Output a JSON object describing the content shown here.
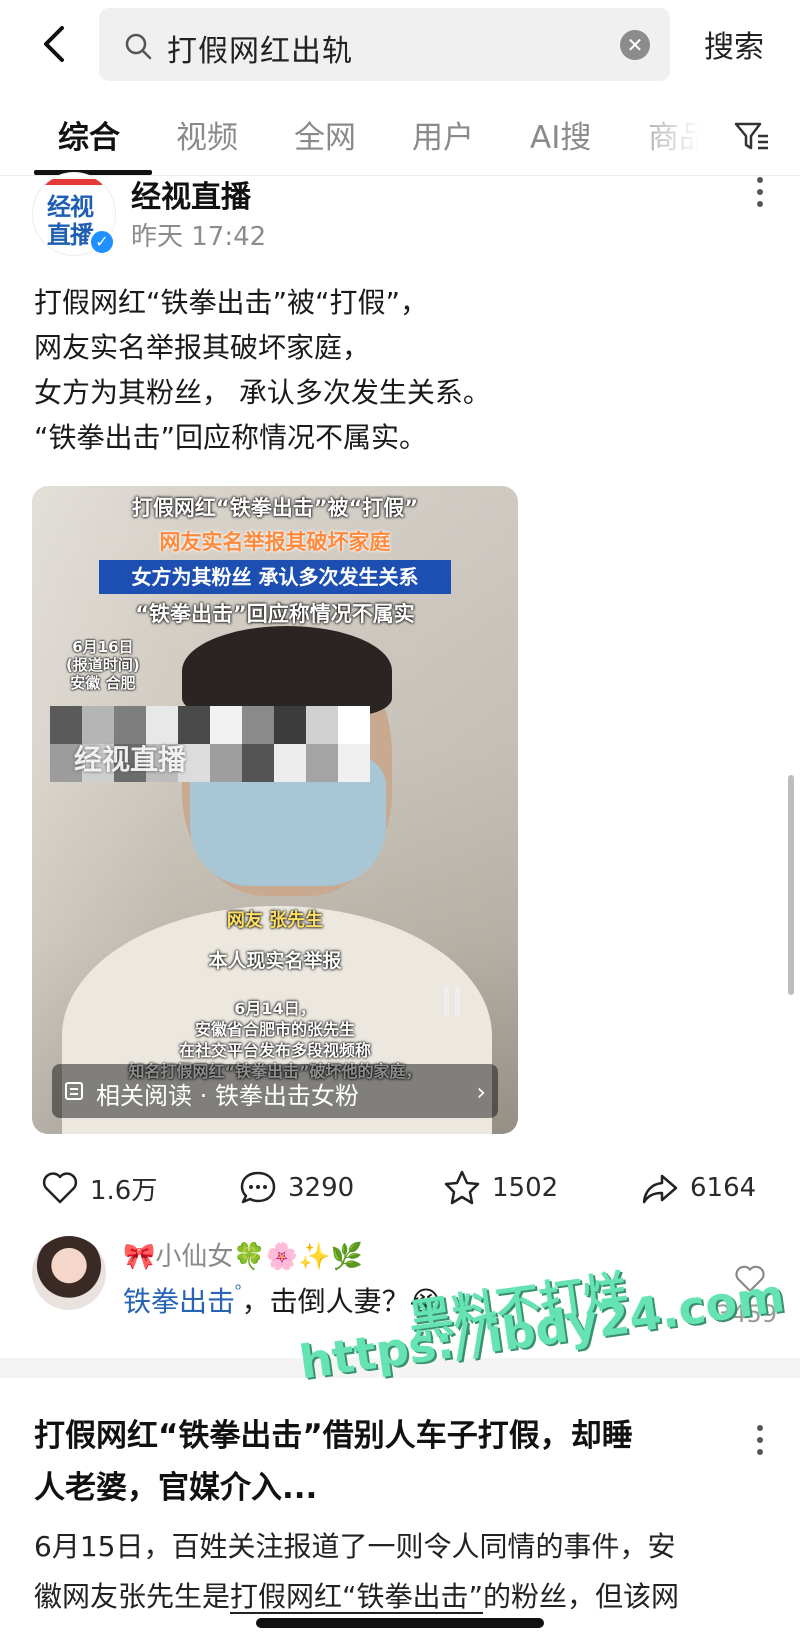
{
  "search": {
    "query": "打假网红出轨",
    "submit_label": "搜索"
  },
  "tabs": [
    {
      "label": "综合",
      "active": true
    },
    {
      "label": "视频"
    },
    {
      "label": "全网"
    },
    {
      "label": "用户"
    },
    {
      "label": "AI搜"
    },
    {
      "label": "商品"
    }
  ],
  "post": {
    "author": "经视直播",
    "avatar_text": [
      "经视",
      "直播"
    ],
    "time": "昨天 17:42",
    "text_lines": [
      "打假网红“铁拳出击”被“打假”，",
      "网友实名举报其破坏家庭，",
      "女方为其粉丝， 承认多次发生关系。",
      "“铁拳出击”回应称情况不属实。"
    ],
    "video": {
      "title_lines": [
        "打假网红“铁拳出击”被“打假”",
        "网友实名举报其破坏家庭",
        "女方为其粉丝 承认多次发生关系",
        "“铁拳出击”回应称情况不属实"
      ],
      "date_lines": [
        "6月16日",
        "(报道时间)",
        "安徽 合肥"
      ],
      "logo": "经视直播",
      "netizen_label": "网友 张先生",
      "report_label": "本人现实名举报",
      "caption_lines": [
        "6月14日，",
        "安徽省合肥市的张先生",
        "在社交平台发布多段视频称",
        "知名打假网红“铁拳出击”破坏他的家庭，"
      ],
      "related_label": "相关阅读 · 铁拳出击女粉"
    },
    "likes": "1.6万",
    "comments": "3290",
    "favorites": "1502",
    "shares": "6164"
  },
  "comment": {
    "name": "🎀小仙女🍀🌸✨🌿",
    "link_text": "铁拳出击",
    "text": "，击倒人妻？😭",
    "like_count": "3459"
  },
  "article": {
    "title_lines": [
      "打假网红“铁拳出击”借别人车子打假，却睡",
      "人老婆，官媒介入..."
    ],
    "body_line1": "6月15日，百姓关注报道了一则令人同情的事件，安",
    "body_line2_pre": "徽网友张先生是",
    "body_line2_link": "打假网红“铁拳出击”",
    "body_line2_post": "的粉丝，但该网"
  },
  "watermark": {
    "line1": "黑料不打烊",
    "line2": "https://ibdy24.com"
  },
  "colors": {
    "link": "#2764b5",
    "verified": "#1e90ff",
    "watermark": "#66e3b3"
  }
}
